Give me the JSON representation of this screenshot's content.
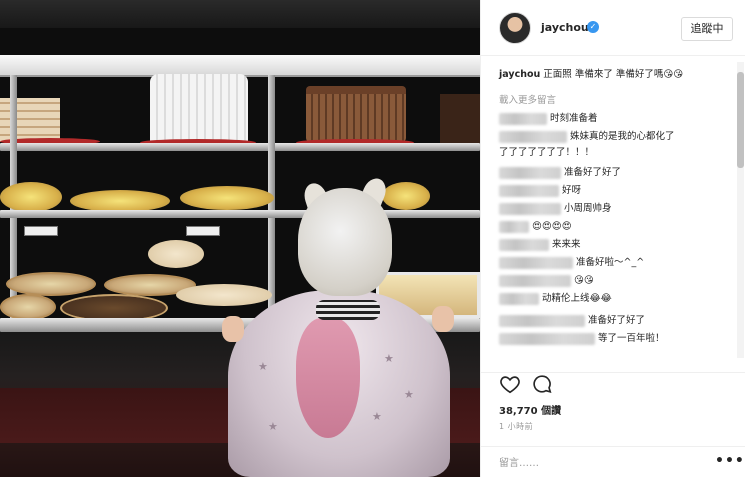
{
  "post": {
    "photo_alt": "child looking at cake display case",
    "username": "jaychou",
    "verified": true,
    "follow_label": "追蹤中"
  },
  "caption": {
    "username": "jaychou",
    "text": "正面照 準備來了 準備好了嗎😘😘"
  },
  "load_more_label": "載入更多留言",
  "comments": [
    {
      "text": "时刻准备着"
    },
    {
      "text": "姝妹真的是我的心都化了"
    },
    {
      "text": "了了了了了了了！！！"
    },
    {
      "text": "准备好了好了"
    },
    {
      "text": "好呀"
    },
    {
      "text": "小周周帅身"
    },
    {
      "text": "😍😍😍😍"
    },
    {
      "text": "来来来"
    },
    {
      "text": "准备好啦～^_^"
    },
    {
      "text": "😘😘"
    },
    {
      "text": "动精伦上线😂😂"
    },
    {
      "text": "准备好了好了"
    },
    {
      "text": "等了一百年啦！"
    }
  ],
  "actions": {
    "like_icon": "heart-icon",
    "comment_icon": "comment-icon"
  },
  "likes_text": "38,770 個讚",
  "time_text": "1 小時前",
  "comment_placeholder": "留言……",
  "more_label": "•••",
  "colors": {
    "verified": "#3897f0",
    "border": "#efefef",
    "text": "#262626",
    "muted": "#999999"
  }
}
